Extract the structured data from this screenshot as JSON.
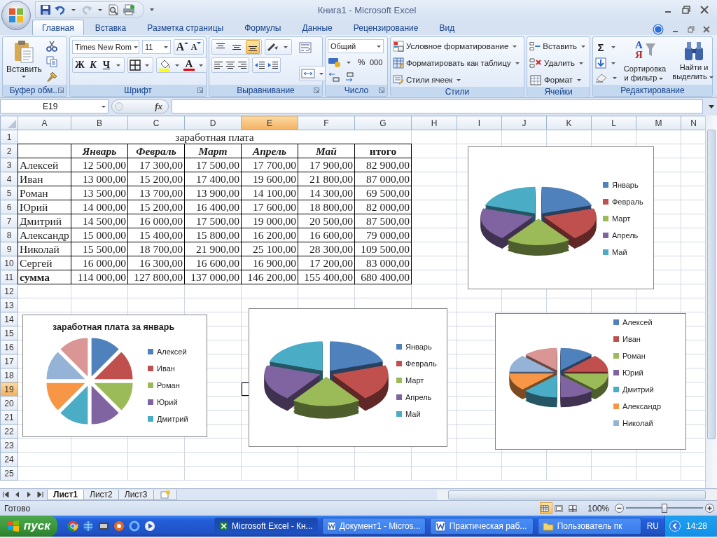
{
  "window": {
    "title": "Книга1 - Microsoft Excel"
  },
  "tabs": [
    {
      "label": "Главная",
      "selected": true
    },
    {
      "label": "Вставка",
      "selected": false
    },
    {
      "label": "Разметка страницы",
      "selected": false
    },
    {
      "label": "Формулы",
      "selected": false
    },
    {
      "label": "Данные",
      "selected": false
    },
    {
      "label": "Рецензирование",
      "selected": false
    },
    {
      "label": "Вид",
      "selected": false
    }
  ],
  "ribbon": {
    "clipboard": {
      "label": "Буфер обм...",
      "paste": "Вставить"
    },
    "font": {
      "label": "Шрифт",
      "family": "Times New Rom",
      "size": "11",
      "grow": "A",
      "shrink": "A",
      "bold": "Ж",
      "italic": "К",
      "underline": "Ч",
      "font_color": "A"
    },
    "alignment": {
      "label": "Выравнивание",
      "vertical": [
        {
          "kind": "top",
          "selected": false
        },
        {
          "kind": "middle",
          "selected": false
        },
        {
          "kind": "bottom",
          "selected": true
        }
      ]
    },
    "number": {
      "label": "Число",
      "format": "Общий",
      "percent": "%",
      "thousands": "000"
    },
    "styles": {
      "label": "Стили",
      "items": [
        {
          "kind": "conditional",
          "label": "Условное форматирование"
        },
        {
          "kind": "table",
          "label": "Форматировать как таблицу"
        },
        {
          "kind": "cell",
          "label": "Стили ячеек"
        }
      ]
    },
    "cells": {
      "label": "Ячейки",
      "items": [
        {
          "kind": "insert",
          "label": "Вставить"
        },
        {
          "kind": "delete",
          "label": "Удалить"
        },
        {
          "kind": "format",
          "label": "Формат"
        }
      ]
    },
    "editing": {
      "label": "Редактирование",
      "sum": "Σ",
      "sort_letters": [
        "А",
        "Я"
      ],
      "sort": "Сортировка и фильтр",
      "find": "Найти и выделить"
    }
  },
  "formula_bar": {
    "name_box": "E19",
    "function_label": "fx"
  },
  "sheet": {
    "columns": [
      {
        "label": "A",
        "selected": false
      },
      {
        "label": "B",
        "selected": false
      },
      {
        "label": "C",
        "selected": false
      },
      {
        "label": "D",
        "selected": false
      },
      {
        "label": "E",
        "selected": true
      },
      {
        "label": "F",
        "selected": false
      },
      {
        "label": "G",
        "selected": false
      },
      {
        "label": "H",
        "selected": false
      },
      {
        "label": "I",
        "selected": false
      },
      {
        "label": "J",
        "selected": false
      },
      {
        "label": "K",
        "selected": false
      },
      {
        "label": "L",
        "selected": false
      },
      {
        "label": "M",
        "selected": false
      },
      {
        "label": "N",
        "selected": false
      }
    ],
    "rows": [
      {
        "label": "1",
        "selected": false
      },
      {
        "label": "2",
        "selected": false
      },
      {
        "label": "3",
        "selected": false
      },
      {
        "label": "4",
        "selected": false
      },
      {
        "label": "5",
        "selected": false
      },
      {
        "label": "6",
        "selected": false
      },
      {
        "label": "7",
        "selected": false
      },
      {
        "label": "8",
        "selected": false
      },
      {
        "label": "9",
        "selected": false
      },
      {
        "label": "10",
        "selected": false
      },
      {
        "label": "11",
        "selected": false
      },
      {
        "label": "12",
        "selected": false
      },
      {
        "label": "13",
        "selected": false
      },
      {
        "label": "14",
        "selected": false
      },
      {
        "label": "15",
        "selected": false
      },
      {
        "label": "16",
        "selected": false
      },
      {
        "label": "17",
        "selected": false
      },
      {
        "label": "18",
        "selected": false
      },
      {
        "label": "19",
        "selected": true
      },
      {
        "label": "20",
        "selected": false
      },
      {
        "label": "21",
        "selected": false
      },
      {
        "label": "22",
        "selected": false
      },
      {
        "label": "23",
        "selected": false
      },
      {
        "label": "24",
        "selected": false
      },
      {
        "label": "25",
        "selected": false
      }
    ]
  },
  "table": {
    "title": "заработная плата",
    "columns": [
      "Январь",
      "Февраль",
      "Март",
      "Апрель",
      "Май",
      "итого"
    ],
    "rows": [
      {
        "name": "Алексей",
        "values": [
          "12 500,00",
          "17 300,00",
          "17 500,00",
          "17 700,00",
          "17 900,00",
          "82 900,00"
        ]
      },
      {
        "name": "Иван",
        "values": [
          "13 000,00",
          "15 200,00",
          "17 400,00",
          "19 600,00",
          "21 800,00",
          "87 000,00"
        ]
      },
      {
        "name": "Роман",
        "values": [
          "13 500,00",
          "13 700,00",
          "13 900,00",
          "14 100,00",
          "14 300,00",
          "69 500,00"
        ]
      },
      {
        "name": "Юрий",
        "values": [
          "14 000,00",
          "15 200,00",
          "16 400,00",
          "17 600,00",
          "18 800,00",
          "82 000,00"
        ]
      },
      {
        "name": "Дмитрий",
        "values": [
          "14 500,00",
          "16 000,00",
          "17 500,00",
          "19 000,00",
          "20 500,00",
          "87 500,00"
        ]
      },
      {
        "name": "Александр",
        "values": [
          "15 000,00",
          "15 400,00",
          "15 800,00",
          "16 200,00",
          "16 600,00",
          "79 000,00"
        ]
      },
      {
        "name": "Николай",
        "values": [
          "15 500,00",
          "18 700,00",
          "21 900,00",
          "25 100,00",
          "28 300,00",
          "109 500,00"
        ]
      },
      {
        "name": "Сергей",
        "values": [
          "16 000,00",
          "16 300,00",
          "16 600,00",
          "16 900,00",
          "17 200,00",
          "83 000,00"
        ]
      }
    ],
    "total": {
      "name": "сумма",
      "values": [
        "114 000,00",
        "127 800,00",
        "137 000,00",
        "146 200,00",
        "155 400,00",
        "680 400,00"
      ]
    }
  },
  "charts": [
    {
      "kind": "pie3d",
      "legend": [
        {
          "label": "Январь",
          "color": "#4f81bd"
        },
        {
          "label": "Февраль",
          "color": "#c0504d"
        },
        {
          "label": "Март",
          "color": "#9bbb59"
        },
        {
          "label": "Апрель",
          "color": "#8064a2"
        },
        {
          "label": "Май",
          "color": "#4bacc6"
        }
      ]
    },
    {
      "kind": "pie",
      "title": "заработная плата за январь",
      "legend": [
        {
          "label": "Алексей",
          "color": "#4f81bd"
        },
        {
          "label": "Иван",
          "color": "#c0504d"
        },
        {
          "label": "Роман",
          "color": "#9bbb59"
        },
        {
          "label": "Юрий",
          "color": "#8064a2"
        },
        {
          "label": "Дмитрий",
          "color": "#4bacc6"
        }
      ]
    },
    {
      "kind": "pie3d",
      "legend": [
        {
          "label": "Январь",
          "color": "#4f81bd"
        },
        {
          "label": "Февраль",
          "color": "#c0504d"
        },
        {
          "label": "Март",
          "color": "#9bbb59"
        },
        {
          "label": "Апрель",
          "color": "#8064a2"
        },
        {
          "label": "Май",
          "color": "#4bacc6"
        }
      ]
    },
    {
      "kind": "pie3d",
      "legend": [
        {
          "label": "Алексей",
          "color": "#4f81bd"
        },
        {
          "label": "Иван",
          "color": "#c0504d"
        },
        {
          "label": "Роман",
          "color": "#9bbb59"
        },
        {
          "label": "Юрий",
          "color": "#8064a2"
        },
        {
          "label": "Дмитрий",
          "color": "#4bacc6"
        },
        {
          "label": "Александр",
          "color": "#f79646"
        },
        {
          "label": "Николай",
          "color": "#95b3d7"
        }
      ]
    }
  ],
  "sheet_tabs": [
    {
      "label": "Лист1",
      "selected": true
    },
    {
      "label": "Лист2",
      "selected": false
    },
    {
      "label": "Лист3",
      "selected": false
    }
  ],
  "status_bar": {
    "text": "Готово",
    "views": [
      {
        "kind": "normal",
        "selected": true
      },
      {
        "kind": "layout",
        "selected": false
      },
      {
        "kind": "page_break",
        "selected": false
      }
    ],
    "zoom": "100%",
    "zoom_slider": {
      "level": 0.5
    }
  },
  "taskbar": {
    "start": "пуск",
    "tasks": [
      {
        "kind": "excel",
        "label": "Microsoft Excel - Кн...",
        "selected": true
      },
      {
        "kind": "word",
        "label": "Документ1 - Micros...",
        "selected": false
      },
      {
        "kind": "word",
        "label": "Практическая раб...",
        "selected": false
      },
      {
        "kind": "folder",
        "label": "Пользователь пк",
        "selected": false
      }
    ],
    "language": "RU",
    "clock": "14:28"
  }
}
